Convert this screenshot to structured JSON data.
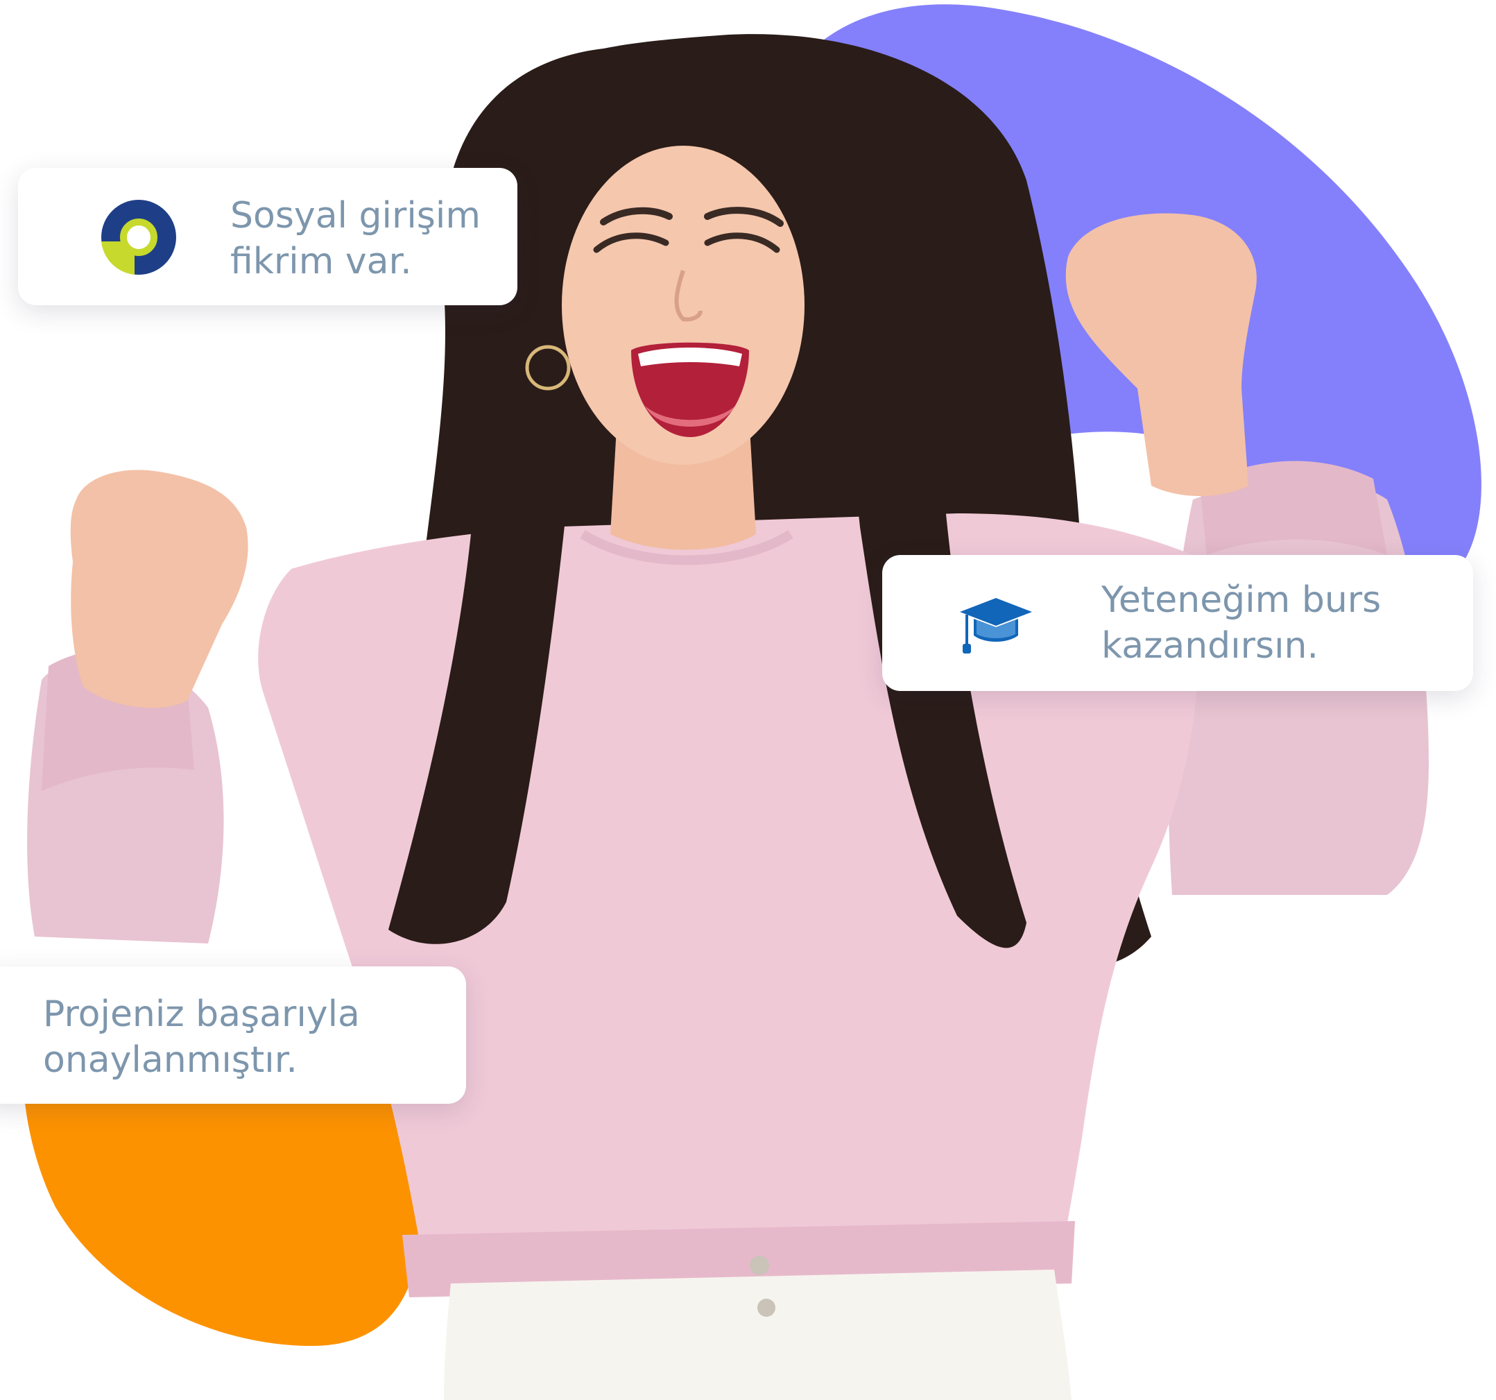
{
  "cards": {
    "idea": {
      "text": "Sosyal girişim\nfikrim var.",
      "icon": "ring-logo-icon"
    },
    "scholarship": {
      "text": "Yeteneğim burs\nkazandırsın.",
      "icon": "graduation-cap-icon"
    },
    "approved": {
      "text": "Projeniz başarıyla\nonaylanmıştır."
    }
  },
  "colors": {
    "purple_blob": "#8480fb",
    "orange_blob": "#fd9200",
    "card_text": "#7d96ad",
    "logo_navy": "#1e3f87",
    "logo_lime": "#c6d92c",
    "cap_blue": "#1166b9"
  }
}
